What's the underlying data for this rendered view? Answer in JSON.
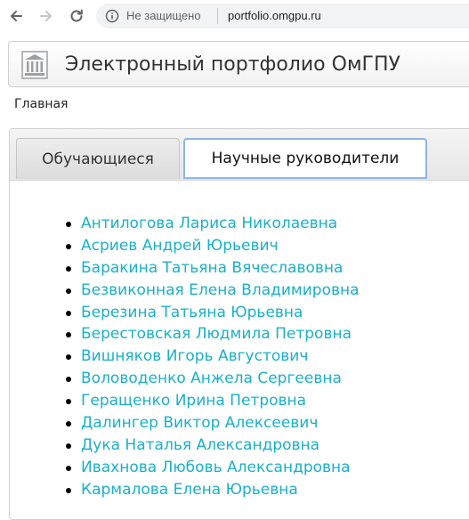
{
  "browser": {
    "security_text": "Не защищено",
    "url": "portfolio.omgpu.ru",
    "icons": {
      "back": "back-arrow-icon",
      "forward": "forward-arrow-icon",
      "reload": "reload-icon",
      "info": "info-icon"
    }
  },
  "header": {
    "logo": "university-building-logo",
    "title": "Электронный портфолио ОмГПУ"
  },
  "nav": {
    "home": "Главная"
  },
  "tabs": [
    {
      "label": "Обучающиеся",
      "active": false
    },
    {
      "label": "Научные руководители",
      "active": true
    }
  ],
  "supervisors": [
    "Антилогова Лариса Николаевна",
    "Асриев Андрей Юрьевич",
    "Баракина Татьяна Вячеславовна",
    "Безвиконная Елена Владимировна",
    "Березина Татьяна Юрьевна",
    "Берестовская Людмила Петровна",
    "Вишняков Игорь Августович",
    "Воловоденко Анжела Сергеевна",
    "Геращенко Ирина Петровна",
    "Далингер Виктор Алексеевич",
    "Дука Наталья Александровна",
    "Ивахнова Любовь Александровна",
    "Кармалова Елена Юрьевна"
  ],
  "colors": {
    "link": "#1ab0c8",
    "active_tab_border": "#8fb4e6"
  }
}
